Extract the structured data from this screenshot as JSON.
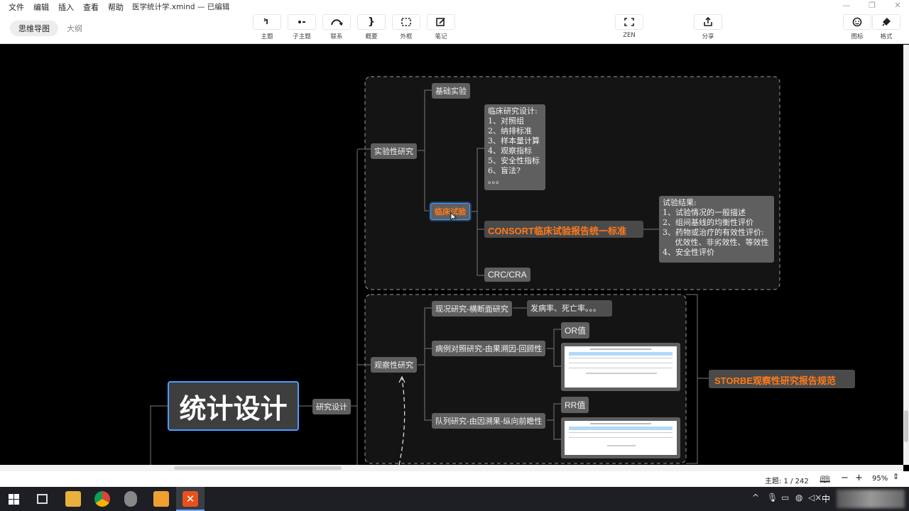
{
  "menubar": {
    "items": [
      "文件",
      "编辑",
      "插入",
      "查看",
      "帮助"
    ],
    "doc_title": "医学统计学.xmind — 已编辑"
  },
  "toolbar": {
    "view_tabs": [
      "思维导图",
      "大纲"
    ],
    "tools": [
      {
        "label": "主题",
        "icon": "topic-icon"
      },
      {
        "label": "子主题",
        "icon": "subtopic-icon"
      },
      {
        "label": "联系",
        "icon": "relationship-icon"
      },
      {
        "label": "概要",
        "icon": "summary-icon"
      },
      {
        "label": "外框",
        "icon": "boundary-icon"
      },
      {
        "label": "笔记",
        "icon": "note-icon"
      },
      {
        "label": "ZEN",
        "icon": "zen-icon"
      },
      {
        "label": "分享",
        "icon": "share-icon"
      },
      {
        "label": "图标",
        "icon": "sticker-icon"
      },
      {
        "label": "格式",
        "icon": "format-icon"
      }
    ]
  },
  "mindmap": {
    "central": "统计设计",
    "research_design": "研究设计",
    "experimental": "实验性研究",
    "basic_exp": "基础实验",
    "clinical_trial": "临床试验",
    "clinical_design_note": "临床研究设计:\n1、对照组\n2、纳排标准\n3、样本量计算\n4、观察指标\n5、安全性指标\n6、盲法?\n。。。",
    "consort": "CONSORT临床试验报告统一标准",
    "crc": "CRC/CRA",
    "result_note": "试验结果:\n1、试验情况的一般描述\n2、组间基线的均衡性评价\n3、药物或治疗的有效性评价:\n     优效性、非劣效性、等效性\n4、安全性评价",
    "observational": "观察性研究",
    "cross_sectional": "现况研究-横断面研究",
    "prevalence": "发病率、死亡率。。。",
    "case_control": "病例对照研究-由果溯因-回顾性",
    "or_value": "OR值",
    "cohort": "队列研究-由因溯果-纵向前瞻性",
    "rr_value": "RR值",
    "strobe": "STORBE观察性研究报告规范"
  },
  "status": {
    "topic_count": "主题: 1 / 242",
    "zoom": "95%"
  },
  "taskbar": {
    "ime": "中"
  }
}
